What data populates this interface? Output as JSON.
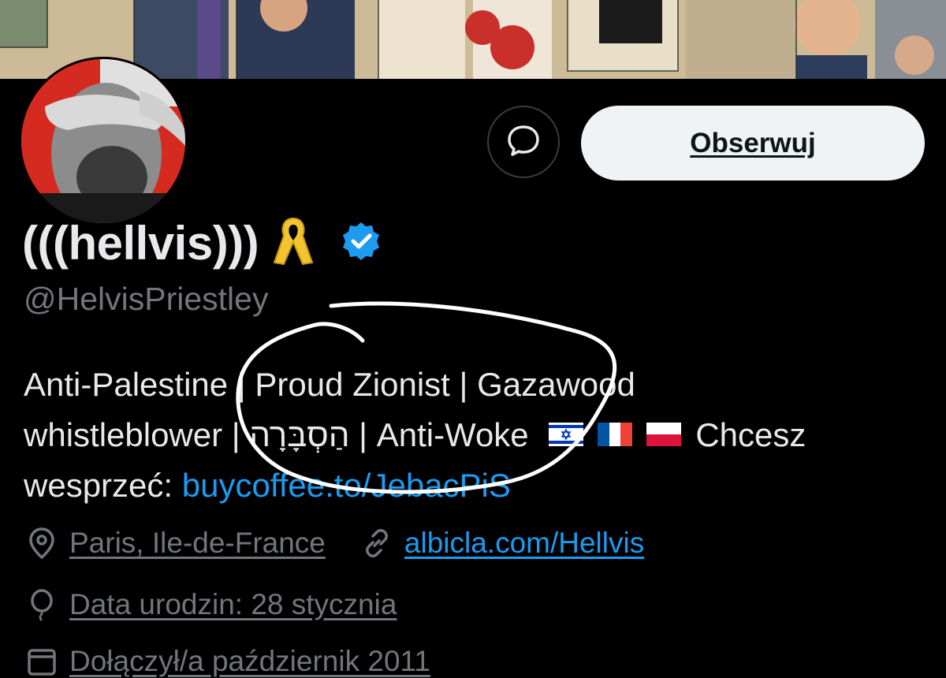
{
  "profile": {
    "follow_label": "Obserwuj",
    "display_name": "(((hellvis)))",
    "handle": "@HelvisPriestley",
    "bio_part1": "Anti-Palestine | Proud Zionist | Gazawood",
    "bio_part2": "whistleblower | הַסְבָּרָה | Anti-Woke",
    "bio_part3": "Chcesz",
    "bio_part4": "wesprzeć:",
    "bio_link": "buycoffee.to/JebacPiS",
    "location": "Paris, Ile-de-France",
    "website": "albicla.com/Hellvis",
    "birthday": "Data urodzin: 28 stycznia",
    "joined": "Dołączył/a październik 2011"
  },
  "icons": {
    "message": "message-bubble-icon",
    "ribbon": "yellow-ribbon-emoji",
    "verified": "verified-badge-icon",
    "location": "location-pin-icon",
    "link": "link-icon",
    "birthday": "balloon-icon",
    "calendar": "calendar-icon",
    "flags": [
      "israel-flag",
      "france-flag",
      "poland-flag"
    ]
  },
  "colors": {
    "background": "#000000",
    "text": "#e7e9ea",
    "secondary": "#71767b",
    "link": "#1d9bf0",
    "verified": "#1d9bf0",
    "follow_button": "#eff3f4"
  }
}
